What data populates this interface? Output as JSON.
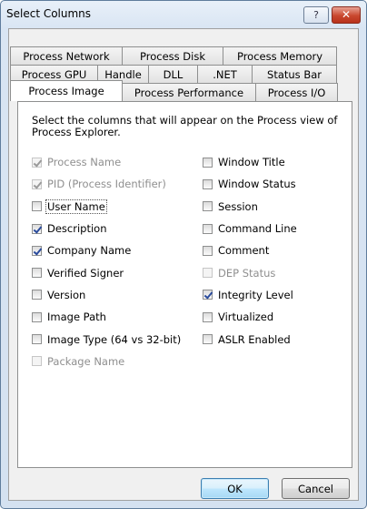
{
  "window": {
    "title": "Select Columns",
    "help_label": "?",
    "close_label": "✕"
  },
  "tabs": {
    "row1": [
      "Process Network",
      "Process Disk",
      "Process Memory"
    ],
    "row2": [
      "Process GPU",
      "Handle",
      "DLL",
      ".NET",
      "Status Bar"
    ],
    "row3": [
      "Process Image",
      "Process Performance",
      "Process I/O"
    ],
    "active": "Process Image"
  },
  "panel": {
    "instructions": "Select the columns that will appear on the Process view of Process Explorer.",
    "left_column": [
      {
        "label": "Process Name",
        "checked": true,
        "disabled": true
      },
      {
        "label": "PID (Process Identifier)",
        "checked": true,
        "disabled": true
      },
      {
        "label": "User Name",
        "checked": false,
        "disabled": false,
        "focused": true
      },
      {
        "label": "Description",
        "checked": true,
        "disabled": false
      },
      {
        "label": "Company Name",
        "checked": true,
        "disabled": false
      },
      {
        "label": "Verified Signer",
        "checked": false,
        "disabled": false
      },
      {
        "label": "Version",
        "checked": false,
        "disabled": false
      },
      {
        "label": "Image Path",
        "checked": false,
        "disabled": false
      },
      {
        "label": "Image Type (64 vs 32-bit)",
        "checked": false,
        "disabled": false
      },
      {
        "label": "Package Name",
        "checked": false,
        "disabled": true
      }
    ],
    "right_column": [
      {
        "label": "Window Title",
        "checked": false,
        "disabled": false
      },
      {
        "label": "Window Status",
        "checked": false,
        "disabled": false
      },
      {
        "label": "Session",
        "checked": false,
        "disabled": false
      },
      {
        "label": "Command Line",
        "checked": false,
        "disabled": false
      },
      {
        "label": "Comment",
        "checked": false,
        "disabled": false
      },
      {
        "label": "DEP Status",
        "checked": false,
        "disabled": true
      },
      {
        "label": "Integrity Level",
        "checked": true,
        "disabled": false
      },
      {
        "label": "Virtualized",
        "checked": false,
        "disabled": false
      },
      {
        "label": "ASLR Enabled",
        "checked": false,
        "disabled": false
      }
    ]
  },
  "footer": {
    "ok_label": "OK",
    "cancel_label": "Cancel"
  },
  "colors": {
    "titlebar": "#d9e5f3",
    "close_button": "#c9472e",
    "checkmark": "#2a4b9c"
  }
}
